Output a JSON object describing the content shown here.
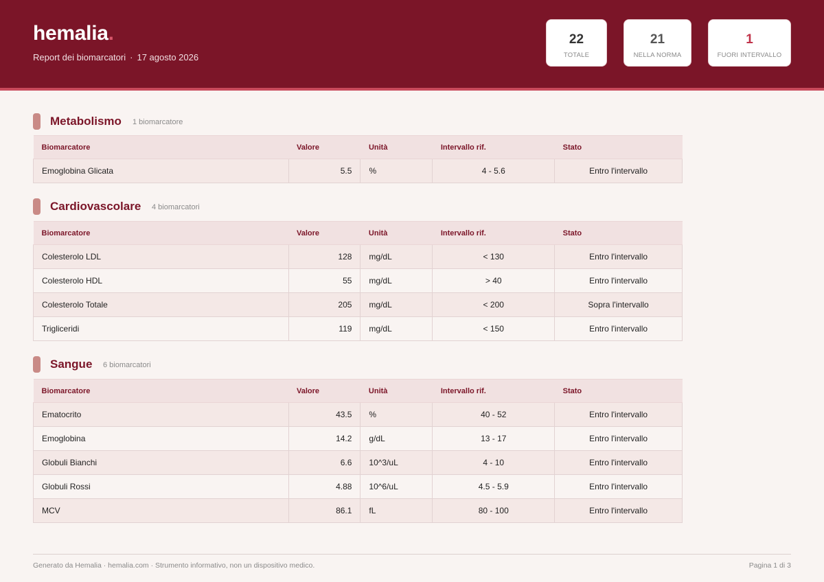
{
  "header": {
    "brand": "hemalia",
    "brand_dot": ".",
    "report_title": "Report dei biomarcatori",
    "separator": "·",
    "date": "17 agosto 2026"
  },
  "stats": {
    "total": {
      "value": "22",
      "label": "TOTALE"
    },
    "normal": {
      "value": "21",
      "label": "NELLA NORMA"
    },
    "out": {
      "value": "1",
      "label": "FUORI INTERVALLO"
    }
  },
  "columns": [
    "Biomarcatore",
    "Valore",
    "Unità",
    "Intervallo rif.",
    "Stato"
  ],
  "sections": [
    {
      "title": "Metabolismo",
      "count": "1 biomarcatore",
      "rows": [
        [
          "Emoglobina Glicata",
          "5.5",
          "%",
          "4 - 5.6",
          "Entro l'intervallo"
        ]
      ]
    },
    {
      "title": "Cardiovascolare",
      "count": "4 biomarcatori",
      "rows": [
        [
          "Colesterolo LDL",
          "128",
          "mg/dL",
          "< 130",
          "Entro l'intervallo"
        ],
        [
          "Colesterolo HDL",
          "55",
          "mg/dL",
          "> 40",
          "Entro l'intervallo"
        ],
        [
          "Colesterolo Totale",
          "205",
          "mg/dL",
          "< 200",
          "Sopra l'intervallo"
        ],
        [
          "Trigliceridi",
          "119",
          "mg/dL",
          "< 150",
          "Entro l'intervallo"
        ]
      ]
    },
    {
      "title": "Sangue",
      "count": "6 biomarcatori",
      "rows": [
        [
          "Ematocrito",
          "43.5",
          "%",
          "40 - 52",
          "Entro l'intervallo"
        ],
        [
          "Emoglobina",
          "14.2",
          "g/dL",
          "13 - 17",
          "Entro l'intervallo"
        ],
        [
          "Globuli Bianchi",
          "6.6",
          "10^3/uL",
          "4 - 10",
          "Entro l'intervallo"
        ],
        [
          "Globuli Rossi",
          "4.88",
          "10^6/uL",
          "4.5 - 5.9",
          "Entro l'intervallo"
        ],
        [
          "MCV",
          "86.1",
          "fL",
          "80 - 100",
          "Entro l'intervallo"
        ]
      ]
    }
  ],
  "footer": {
    "left": "Generato da Hemalia · hemalia.com · Strumento informativo, non un dispositivo medico.",
    "right": "Pagina 1 di 3"
  }
}
